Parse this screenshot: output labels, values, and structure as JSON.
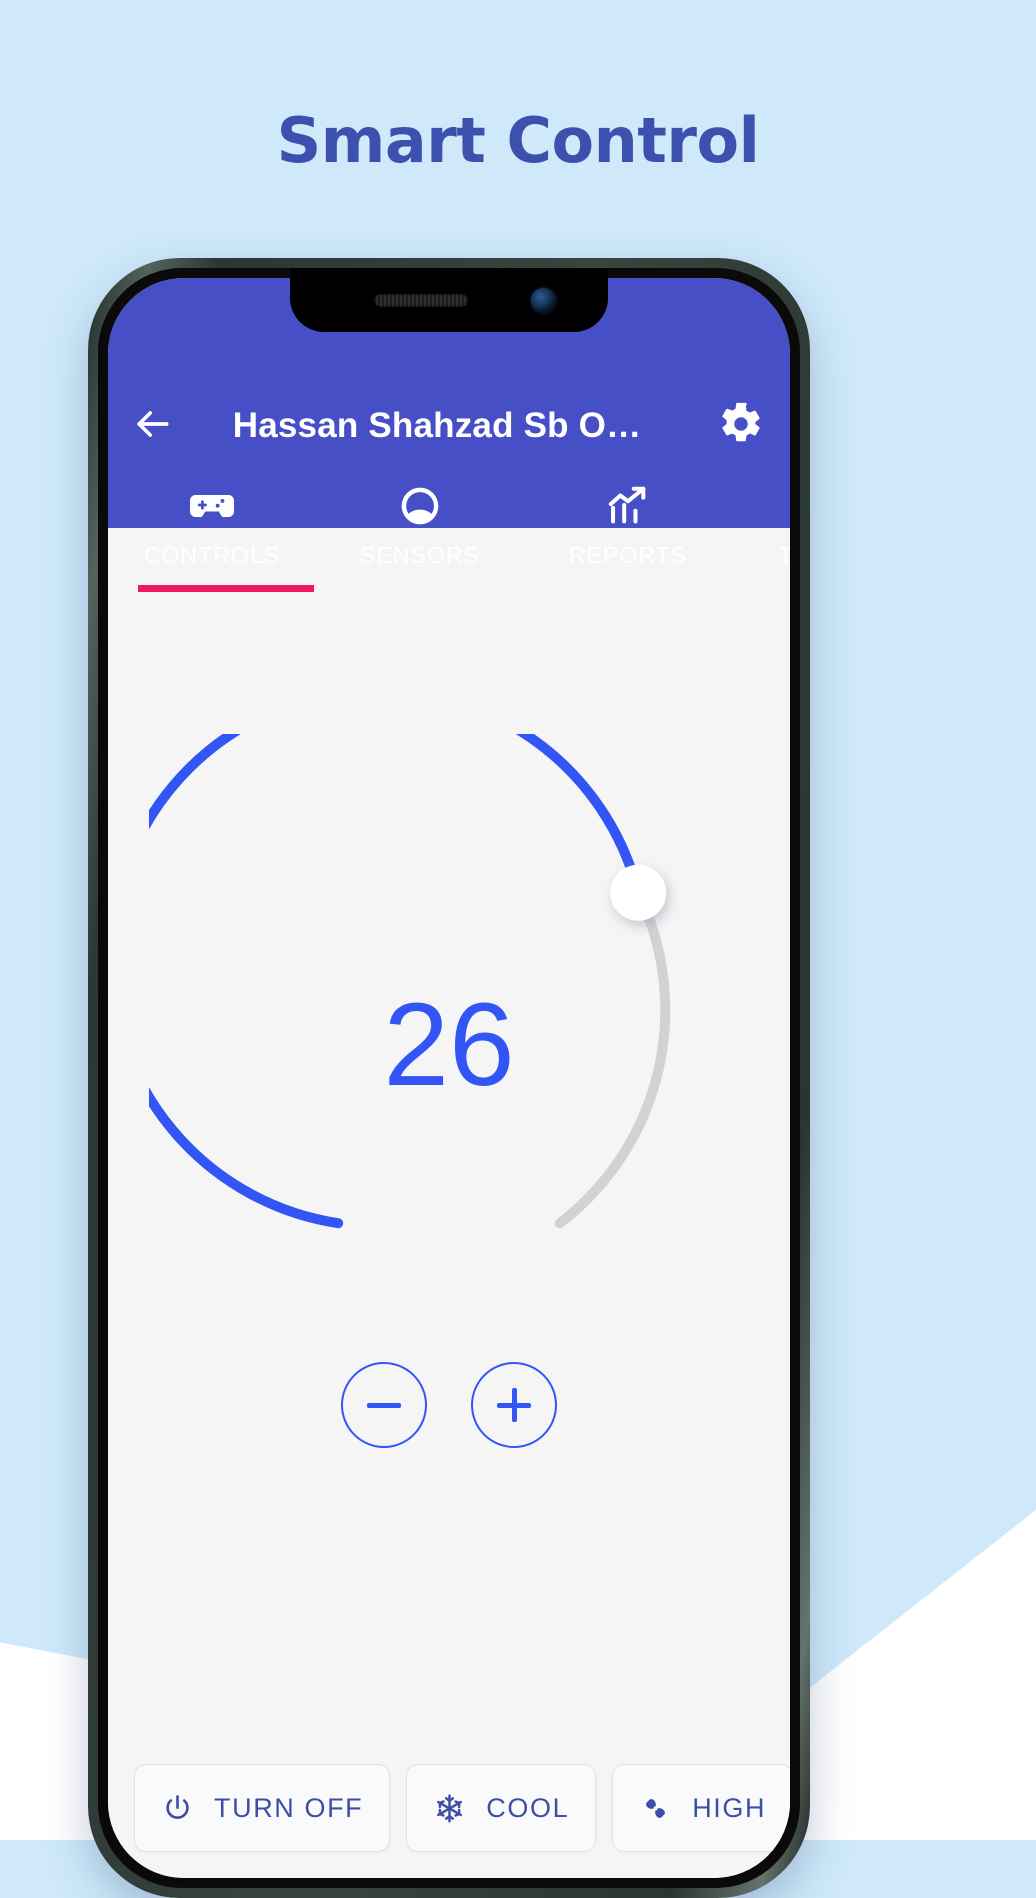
{
  "page": {
    "headline": "Smart Control",
    "background_color": "#cfe9fb",
    "accent_color": "#3355f5",
    "appbar_color": "#474fc6",
    "indicator_color": "#ef1b5e"
  },
  "appbar": {
    "back_icon": "arrow-left-icon",
    "title": "Hassan Shahzad Sb O…",
    "settings_icon": "gear-icon"
  },
  "tabs": [
    {
      "label": "CONTROLS",
      "icon": "gamepad-icon",
      "selected": true
    },
    {
      "label": "SENSORS",
      "icon": "gauge-icon",
      "selected": false
    },
    {
      "label": "REPORTS",
      "icon": "bar-chart-trend-icon",
      "selected": false
    },
    {
      "label": "TIMELINE",
      "icon": "history-clock-icon",
      "selected": false
    }
  ],
  "dial": {
    "value": "26",
    "unit": "",
    "min": 16,
    "max": 30,
    "track_color": "#d2d2d4",
    "progress_color": "#3355f5",
    "handle_color": "#ffffff",
    "sweep_percent": 78
  },
  "stepper": {
    "decrease_label": "−",
    "decrease_icon": "minus-icon",
    "increase_label": "+",
    "increase_icon": "plus-icon"
  },
  "chips": [
    {
      "label": "TURN OFF",
      "icon": "power-icon"
    },
    {
      "label": "COOL",
      "icon": "snowflake-icon"
    },
    {
      "label": "HIGH",
      "icon": "fan-icon"
    }
  ]
}
